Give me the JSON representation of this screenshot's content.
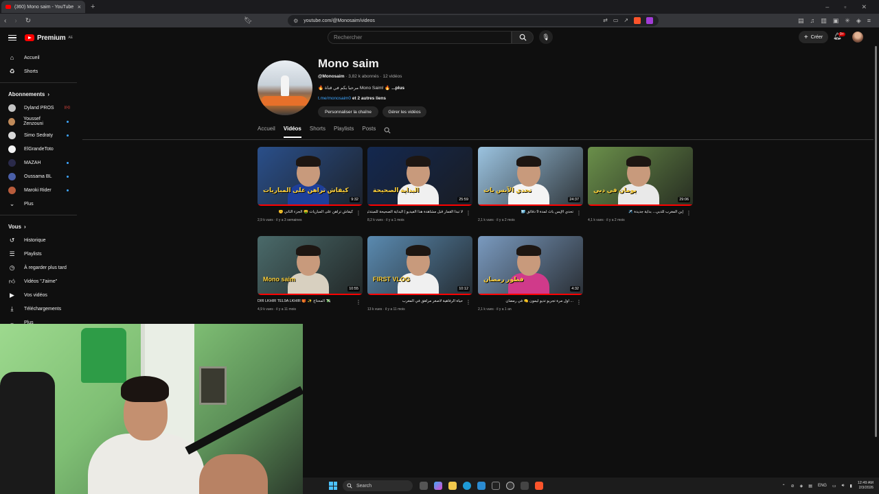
{
  "browser": {
    "tab_title": "(360) Mono saim - YouTube",
    "url": "youtube.com/@Monosaim/videos"
  },
  "header": {
    "logo": "Premium",
    "country_code": "AE",
    "search_placeholder": "Rechercher",
    "create_label": "Créer",
    "notif_count": "9+"
  },
  "sidebar": {
    "main": [
      {
        "label": "Accueil",
        "icon": "home-icon"
      },
      {
        "label": "Shorts",
        "icon": "shorts-icon"
      }
    ],
    "subs_title": "Abonnements",
    "subs": [
      {
        "label": "Dyland PROS",
        "status": "live",
        "color": "#c4c4c4"
      },
      {
        "label": "Youssef Zenzouni",
        "status": "dot",
        "color": "#c08a5a"
      },
      {
        "label": "Simo Sedraty",
        "status": "dot",
        "color": "#d8d8d8"
      },
      {
        "label": "ElGrandeToto",
        "status": "",
        "color": "#f4f4f4"
      },
      {
        "label": "MAZAH",
        "status": "dot",
        "color": "#2a2a4a"
      },
      {
        "label": "Oussama BL",
        "status": "dot",
        "color": "#4a5fa8"
      },
      {
        "label": "Maroki Rider",
        "status": "dot",
        "color": "#b85c3c"
      },
      {
        "label": "Plus",
        "status": "",
        "color": ""
      }
    ],
    "you_title": "Vous",
    "you": [
      {
        "label": "Historique",
        "icon": "history-icon"
      },
      {
        "label": "Playlists",
        "icon": "playlists-icon"
      },
      {
        "label": "À regarder plus tard",
        "icon": "watch-later-icon"
      },
      {
        "label": "Vidéos \"J'aime\"",
        "icon": "like-icon"
      },
      {
        "label": "Vos vidéos",
        "icon": "your-videos-icon"
      },
      {
        "label": "Téléchargements",
        "icon": "download-icon"
      },
      {
        "label": "Plus",
        "icon": "chevron-down-icon"
      }
    ]
  },
  "channel": {
    "name": "Mono saim",
    "handle": "@Monosaim",
    "meta": " · 3,82 k abonnés · 12 vidéos",
    "desc": "🔥 مرحبا بكم في قناة Mono Saim! 🔥",
    "desc_more": "...plus",
    "link": "t.me/monosaim0",
    "link_more": " et 2 autres liens",
    "btn_customize": "Personnaliser la chaîne",
    "btn_manage": "Gérer les vidéos"
  },
  "tabs": [
    "Accueil",
    "Vidéos",
    "Shorts",
    "Playlists",
    "Posts"
  ],
  "videos": [
    {
      "title": "كيفاش تراهن على المباريات 🤑 الجزء الثاني 🤫",
      "meta": "2,9 k vues · il y a 3 semaines",
      "duration": "9:32",
      "bg": "#2a4f8a",
      "shirt": "#1e3f9a",
      "caption": "كيفاش تراهن على المباريات"
    },
    {
      "title": "لا تبدا القمار قبل مشاهدة هذا الفيديو | البداية الصحيحة للمبتدئين",
      "meta": "8,2 k vues · il y a 1 mois",
      "duration": "25:59",
      "bg": "#14284f",
      "shirt": "#f0f0f0",
      "caption": "البداية الصحيحة"
    },
    {
      "title": "تحدي الإيس باث لمدة 9 دقائق 🧊",
      "meta": "2,1 k vues · il y a 2 mois",
      "duration": "24:37",
      "bg": "#9bc3e0",
      "shirt": "#f4f4f4",
      "caption": "تحدي الآيس باث"
    },
    {
      "title": "إبن المغرب للدبي... بداية جديدة ✈️",
      "meta": "4,1 k vues · il y a 2 mois",
      "duration": "29:06",
      "bg": "#6a8f4a",
      "shirt": "#e9e9e9",
      "caption": "يومان في دبي"
    },
    {
      "title": "DIR LKHIR TEL9A LKHIR 🎁 ✨ المحتاج 💸",
      "meta": "4,9 k vues · il y a 11 mois",
      "duration": "10:55",
      "bg": "#4a6a6a",
      "shirt": "#d8d0c0",
      "caption": "Mono saim"
    },
    {
      "title": "حياة الرفاهية لأصغر مراهق في المغرب",
      "meta": "13 k vues · il y a 11 mois",
      "duration": "10:12",
      "bg": "#5a8ab0",
      "shirt": "#f0f0f0",
      "caption": "FIRST VLOG"
    },
    {
      "title": "... أول مرة تجربو تديو ليمون 🍋 في رمضان",
      "meta": "2,1 k vues · il y a 1 an",
      "duration": "4:32",
      "bg": "#7a9abf",
      "shirt": "#d03a8a",
      "caption": "فطور رمضان"
    }
  ],
  "taskbar": {
    "search": "Search",
    "lang": "ENG",
    "time": "12:49 AM",
    "date": "2/3/2026"
  },
  "colors": {
    "accent": "#ff0000",
    "link": "#3ea6ff",
    "bg": "#0f0f0f"
  }
}
